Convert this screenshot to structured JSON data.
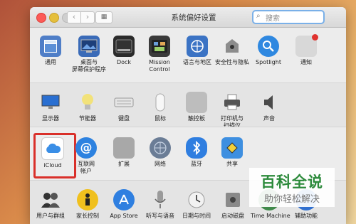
{
  "window": {
    "title": "系统偏好设置",
    "search_placeholder": "搜索",
    "nav_back": "‹",
    "nav_forward": "›",
    "grid_icon_glyph": "▦"
  },
  "rows": [
    [
      {
        "label": "通用",
        "icon": "general-icon",
        "color": "#4f7ec7"
      },
      {
        "label": "桌面与",
        "label2": "屏幕保护程序",
        "icon": "desktop-icon",
        "color": "#3a6bb8"
      },
      {
        "label": "Dock",
        "icon": "dock-icon",
        "color": "#2b2b2b"
      },
      {
        "label": "Mission",
        "label2": "Control",
        "icon": "mission-control-icon",
        "color": "#3a3a3a"
      },
      {
        "label": "语言与地区",
        "icon": "language-region-icon",
        "color": "#3b73c4"
      },
      {
        "label": "安全性与隐私",
        "icon": "security-privacy-icon",
        "color": "#8c8c8c"
      },
      {
        "label": "Spotlight",
        "icon": "spotlight-icon",
        "color": "#2f88e0"
      },
      {
        "label": "通知",
        "icon": "notifications-icon",
        "color": "#d8d8d8"
      }
    ],
    [
      {
        "label": "显示器",
        "icon": "displays-icon",
        "color": "#2a6fd1"
      },
      {
        "label": "节能器",
        "icon": "energy-saver-icon",
        "color": "#f2e27a"
      },
      {
        "label": "键盘",
        "icon": "keyboard-icon",
        "color": "#d6d6d6"
      },
      {
        "label": "鼠标",
        "icon": "mouse-icon",
        "color": "#f4f4f4"
      },
      {
        "label": "触控板",
        "icon": "trackpad-icon",
        "color": "#bdbdbd"
      },
      {
        "label": "打印机与",
        "label2": "扫描仪",
        "icon": "printers-icon",
        "color": "#555555"
      },
      {
        "label": "声音",
        "icon": "sound-icon",
        "color": "#4a4a4a"
      }
    ],
    [
      {
        "label": "iCloud",
        "icon": "icloud-icon",
        "color": "#3a8ee6"
      },
      {
        "label": "互联网",
        "label2": "帐户",
        "icon": "internet-accounts-icon",
        "color": "#2d82e0"
      },
      {
        "label": "扩展",
        "icon": "extensions-icon",
        "color": "#a8a8a8"
      },
      {
        "label": "网络",
        "icon": "network-icon",
        "color": "#6b7d96"
      },
      {
        "label": "蓝牙",
        "icon": "bluetooth-icon",
        "color": "#2f7ee0"
      },
      {
        "label": "共享",
        "icon": "sharing-icon",
        "color": "#3e8fe0"
      }
    ],
    [
      {
        "label": "用户与群组",
        "icon": "users-groups-icon",
        "color": "#333333"
      },
      {
        "label": "家长控制",
        "icon": "parental-controls-icon",
        "color": "#f0c01e"
      },
      {
        "label": "App Store",
        "icon": "app-store-icon",
        "color": "#2f7fe0"
      },
      {
        "label": "听写与语音",
        "icon": "dictation-speech-icon",
        "color": "#9a9a9a"
      },
      {
        "label": "日期与时间",
        "icon": "date-time-icon",
        "color": "#f2f2f2"
      },
      {
        "label": "启动磁盘",
        "icon": "startup-disk-icon",
        "color": "#8a8a8a"
      },
      {
        "label": "Time Machine",
        "icon": "time-machine-icon",
        "color": "#3f8a4a"
      },
      {
        "label": "辅助功能",
        "icon": "accessibility-icon",
        "color": "#2f6fd0"
      }
    ]
  ],
  "watermark": {
    "title": "百科全说",
    "subtitle": "助你轻松解决"
  }
}
